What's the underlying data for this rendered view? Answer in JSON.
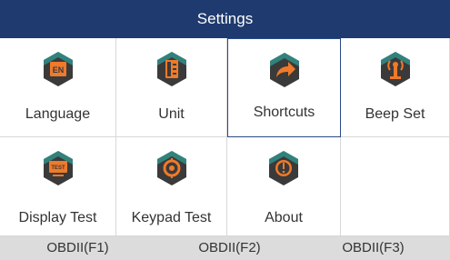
{
  "header": {
    "title": "Settings"
  },
  "grid": {
    "items": [
      {
        "label": "Language",
        "icon": "language-icon"
      },
      {
        "label": "Unit",
        "icon": "unit-icon"
      },
      {
        "label": "Shortcuts",
        "icon": "shortcuts-icon",
        "selected": true
      },
      {
        "label": "Beep Set",
        "icon": "beep-icon"
      },
      {
        "label": "Display Test",
        "icon": "display-test-icon"
      },
      {
        "label": "Keypad Test",
        "icon": "keypad-test-icon"
      },
      {
        "label": "About",
        "icon": "about-icon"
      }
    ]
  },
  "footer": {
    "f1": "OBDII(F1)",
    "f2": "OBDII(F2)",
    "f3": "OBDII(F3)"
  },
  "colors": {
    "title_bar": "#1f3a6e",
    "icon_hex": "#3a3a3a",
    "icon_accent": "#f07a2a",
    "icon_teal": "#2bb3a8",
    "selection_border": "#2a4a86",
    "footer_bg": "#dcdcdc"
  }
}
